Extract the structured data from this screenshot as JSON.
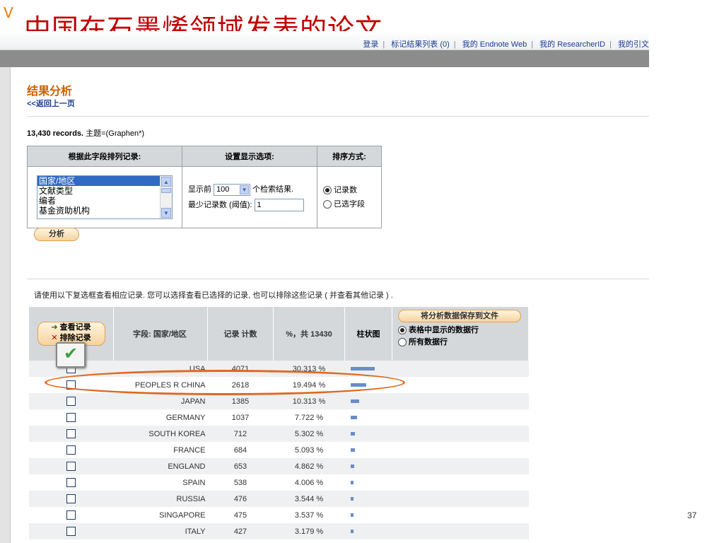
{
  "slide": {
    "title": "中国在石墨烯领域发表的论文",
    "corner_mark": "V",
    "page_number": "37",
    "dots": ".."
  },
  "topnav": {
    "links": [
      "登录",
      "标记结果列表 (0)",
      "我的 Endnote Web",
      "我的 ResearcherID",
      "我的引文"
    ]
  },
  "analysis": {
    "title": "结果分析",
    "back_link": "<<返回上一页",
    "records_count": "13,430 records.",
    "query": "主题=(Graphen*)"
  },
  "options": {
    "field_header": "根据此字段排列记录:",
    "display_header": "设置显示选项:",
    "sort_header": "排序方式:",
    "fields": [
      "国家/地区",
      "文献类型",
      "编者",
      "基金资助机构"
    ],
    "show_prefix": "显示前",
    "show_value": "100",
    "show_suffix": "个检索结果.",
    "min_label": "最少记录数 (阈值):",
    "min_value": "1",
    "sort_record_count": "记录数",
    "sort_selected_field": "已选字段",
    "analyze_button": "分析"
  },
  "hint": "请使用以下复选框查看相应记录. 您可以选择查看已选择的记录, 也可以排除这些记录 ( 并查看其他记录 ) .",
  "results": {
    "view_button": "查看记录",
    "exclude_button": "排除记录",
    "col_field": "字段: 国家/地区",
    "col_count": "记录 计数",
    "col_pct": "%，共 13430",
    "col_bar": "柱状图",
    "save_button": "将分析数据保存到文件",
    "save_opt_table": "表格中显示的数据行",
    "save_opt_all": "所有数据行",
    "rows": [
      {
        "field": "USA",
        "count": "4071",
        "pct": "30.313 %",
        "value": 30.313
      },
      {
        "field": "PEOPLES R CHINA",
        "count": "2618",
        "pct": "19.494 %",
        "value": 19.494
      },
      {
        "field": "JAPAN",
        "count": "1385",
        "pct": "10.313 %",
        "value": 10.313
      },
      {
        "field": "GERMANY",
        "count": "1037",
        "pct": "7.722 %",
        "value": 7.722
      },
      {
        "field": "SOUTH KOREA",
        "count": "712",
        "pct": "5.302 %",
        "value": 5.302
      },
      {
        "field": "FRANCE",
        "count": "684",
        "pct": "5.093 %",
        "value": 5.093
      },
      {
        "field": "ENGLAND",
        "count": "653",
        "pct": "4.862 %",
        "value": 4.862
      },
      {
        "field": "SPAIN",
        "count": "538",
        "pct": "4.006 %",
        "value": 4.006
      },
      {
        "field": "RUSSIA",
        "count": "476",
        "pct": "3.544 %",
        "value": 3.544
      },
      {
        "field": "SINGAPORE",
        "count": "475",
        "pct": "3.537 %",
        "value": 3.537
      },
      {
        "field": "ITALY",
        "count": "427",
        "pct": "3.179 %",
        "value": 3.179
      }
    ]
  },
  "colors": {
    "title_red": "#c00000",
    "heading_orange": "#d06000",
    "link_blue": "#1a3d8f",
    "bar_blue": "#6a8cc8",
    "highlight_orange": "#e06820"
  }
}
